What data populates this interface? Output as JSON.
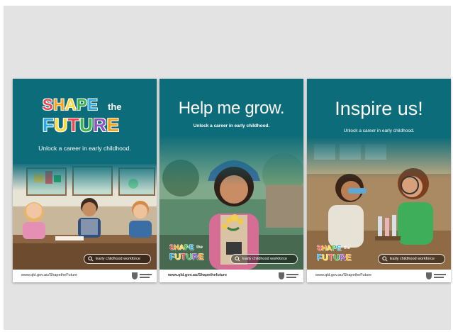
{
  "posters": [
    {
      "logo": {
        "shape": [
          "S",
          "H",
          "A",
          "P",
          "E"
        ],
        "the": "the",
        "future": [
          "F",
          "U",
          "T",
          "U",
          "R",
          "E"
        ]
      },
      "tagline": "Unlock a career in early childhood.",
      "search_label": "Early childhood workforce",
      "footer_url": "www.qld.gov.au/ShapetheFuture"
    },
    {
      "headline": "Help me grow.",
      "tagline": "Unlock a career in early childhood.",
      "logo": {
        "shape": [
          "S",
          "H",
          "A",
          "P",
          "E"
        ],
        "the": "the",
        "future": [
          "F",
          "U",
          "T",
          "U",
          "R",
          "E"
        ]
      },
      "search_label": "Early childhood workforce",
      "footer_url": "www.qld.gov.au/Shapethefuture"
    },
    {
      "headline": "Inspire us!",
      "tagline": "Unlock a career in early childhood.",
      "logo": {
        "shape": [
          "S",
          "H",
          "A",
          "P",
          "E"
        ],
        "the": "the",
        "future": [
          "F",
          "U",
          "T",
          "U",
          "R",
          "E"
        ]
      },
      "search_label": "Early childhood workforce",
      "footer_url": "www.qld.gov.au/ShapetheFuture"
    }
  ],
  "colors": {
    "poster_teal": "#0d6c79",
    "background_grey": "#e3e3e3",
    "logo_letters": [
      "#f0474c",
      "#f7a21b",
      "#ffd83a",
      "#39b54a",
      "#29a9e1",
      "#8e55c5"
    ]
  },
  "icons": {
    "search": "magnifier-icon",
    "government": "queensland-government-crest-icon"
  }
}
